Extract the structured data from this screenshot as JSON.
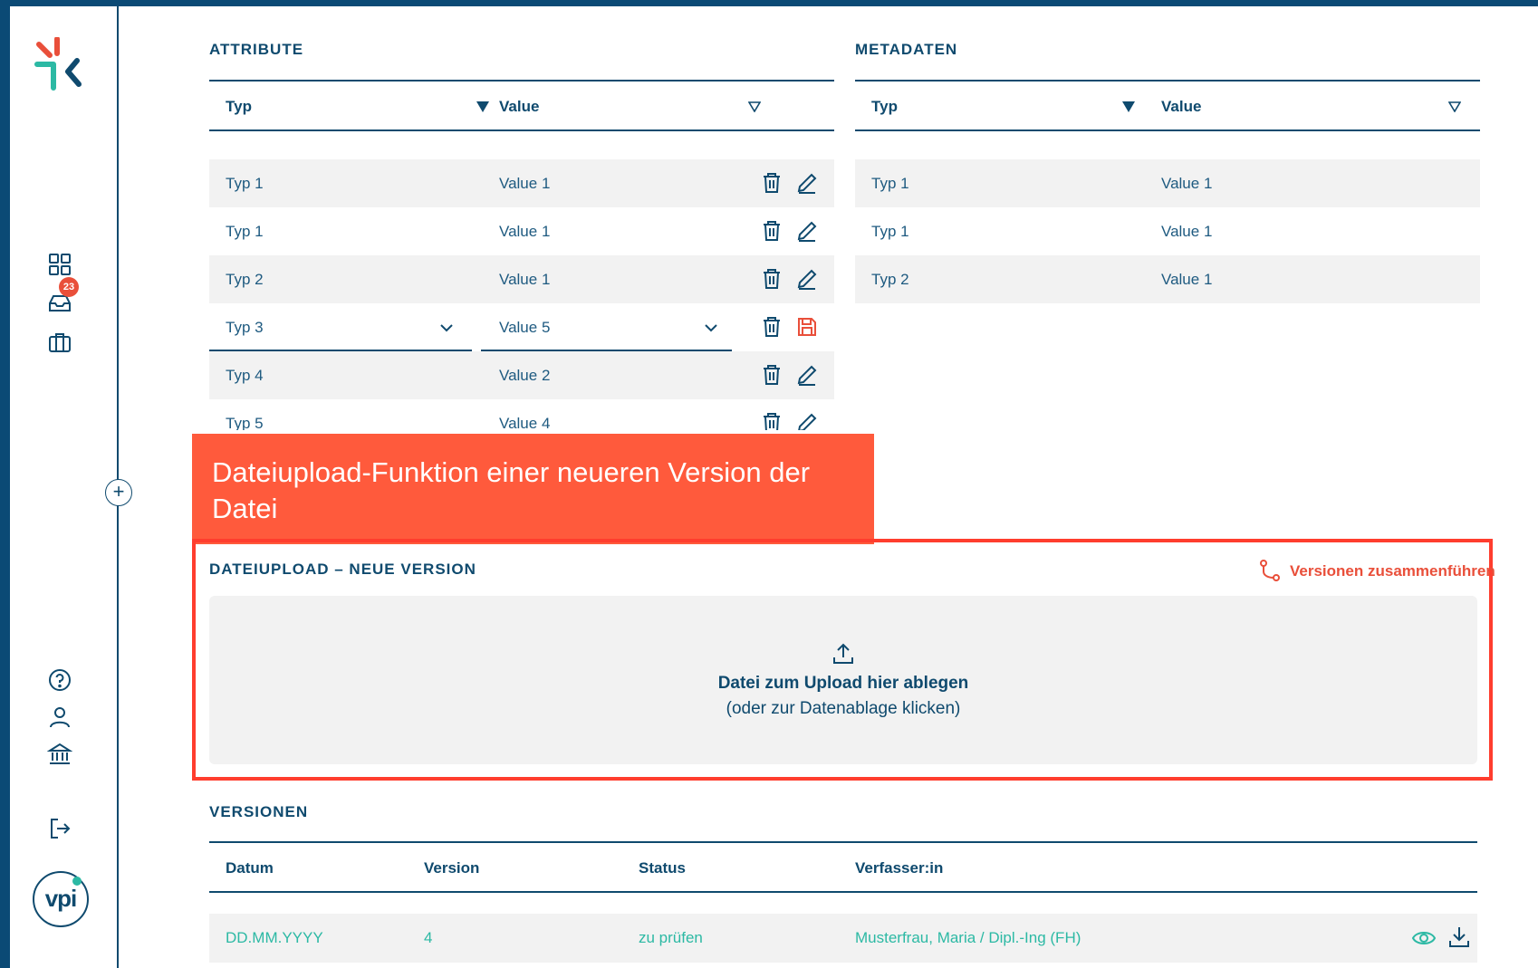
{
  "sidebar": {
    "inbox_badge": "23",
    "logo_text": "vpi",
    "icons": [
      "dashboard-icon",
      "inbox-icon",
      "briefcase-icon",
      "help-icon",
      "user-icon",
      "institution-icon",
      "logout-icon"
    ]
  },
  "attribute": {
    "title": "ATTRIBUTE",
    "col_typ": "Typ",
    "col_value": "Value",
    "rows": [
      {
        "typ": "Typ 1",
        "value": "Value 1"
      },
      {
        "typ": "Typ 1",
        "value": "Value 1"
      },
      {
        "typ": "Typ 2",
        "value": "Value 1"
      },
      {
        "typ": "Typ 3",
        "value": "Value 5"
      },
      {
        "typ": "Typ 4",
        "value": "Value 2"
      },
      {
        "typ": "Typ 5",
        "value": "Value 4"
      }
    ]
  },
  "metadaten": {
    "title": "METADATEN",
    "col_typ": "Typ",
    "col_value": "Value",
    "rows": [
      {
        "typ": "Typ 1",
        "value": "Value 1"
      },
      {
        "typ": "Typ 1",
        "value": "Value 1"
      },
      {
        "typ": "Typ 2",
        "value": "Value 1"
      }
    ]
  },
  "callout": {
    "text": "Dateiupload-Funktion einer neueren Version der Datei"
  },
  "upload": {
    "title": "DATEIUPLOAD – NEUE VERSION",
    "merge_label": "Versionen zusammenführen",
    "drop_main": "Datei zum Upload hier ablegen",
    "drop_sub": "(oder zur Datenablage klicken)"
  },
  "versionen": {
    "title": "VERSIONEN",
    "columns": [
      "Datum",
      "Version",
      "Status",
      "Verfasser:in"
    ],
    "rows": [
      {
        "datum": "DD.MM.YYYY",
        "version": "4",
        "status": "zu prüfen",
        "verfasser": "Musterfrau, Maria / Dipl.-Ing (FH)"
      }
    ]
  },
  "colors": {
    "primary": "#0f4a6e",
    "accent": "#e94f3a",
    "callout": "#ff5a3c",
    "teal": "#2cb9a4",
    "row_bg": "#f2f2f2"
  }
}
